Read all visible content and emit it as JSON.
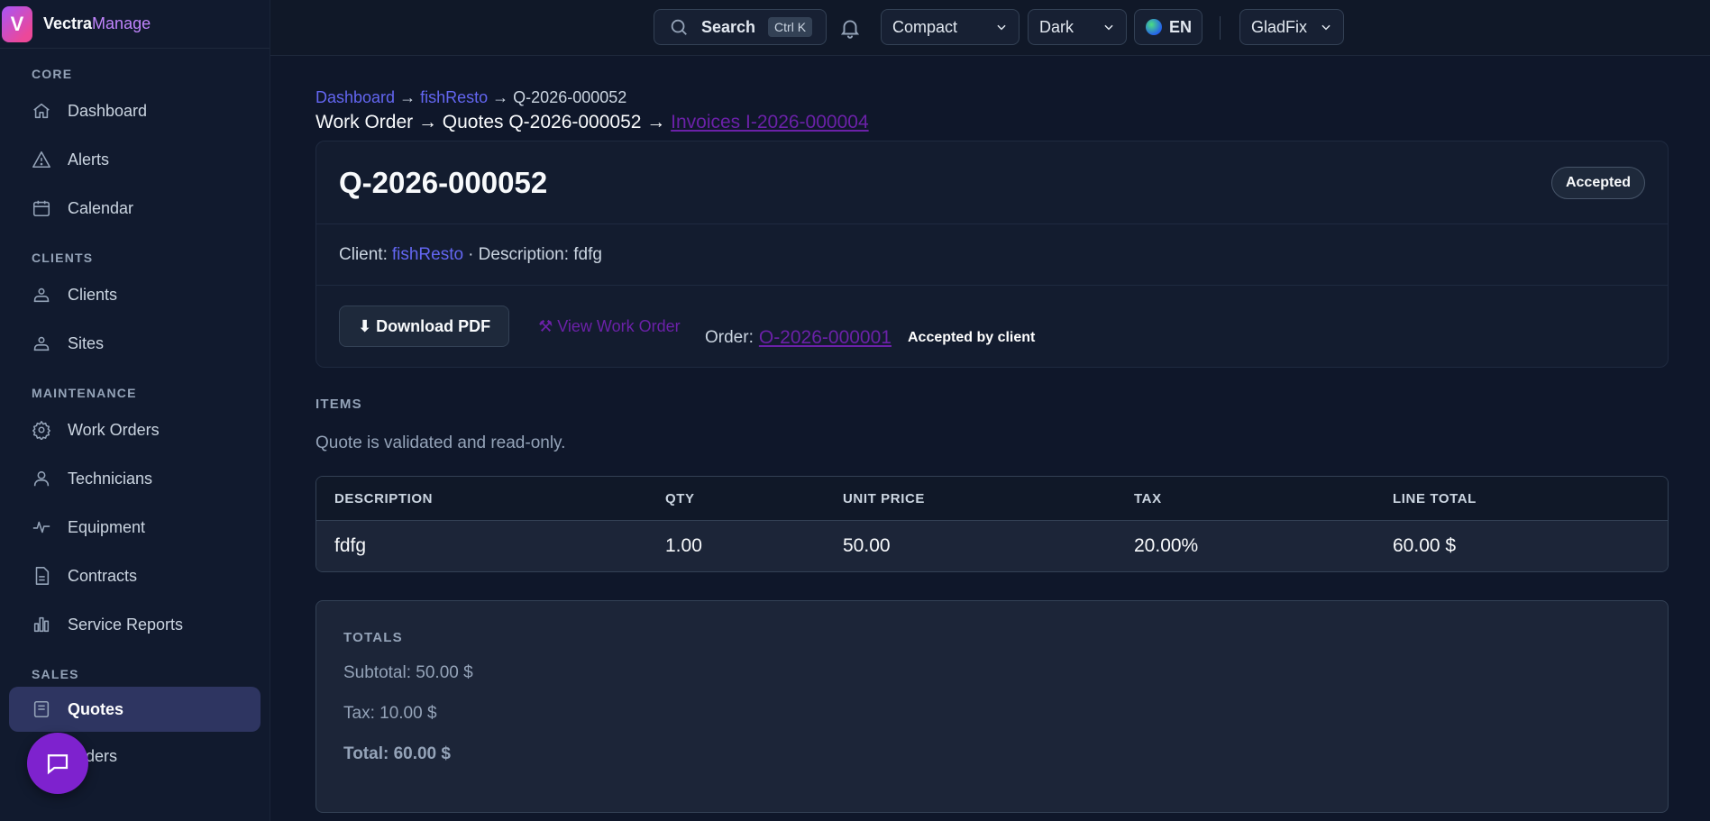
{
  "brand": {
    "part1": "Vectra",
    "part2": "Manage",
    "logo_letter": "V"
  },
  "sidebar": {
    "sections": [
      {
        "title": "CORE",
        "items": [
          {
            "label": "Dashboard",
            "icon": "home-icon"
          },
          {
            "label": "Alerts",
            "icon": "alert-triangle-icon"
          },
          {
            "label": "Calendar",
            "icon": "calendar-icon"
          }
        ]
      },
      {
        "title": "CLIENTS",
        "items": [
          {
            "label": "Clients",
            "icon": "users-icon"
          },
          {
            "label": "Sites",
            "icon": "sites-icon"
          }
        ]
      },
      {
        "title": "MAINTENANCE",
        "items": [
          {
            "label": "Work Orders",
            "icon": "gear-icon"
          },
          {
            "label": "Technicians",
            "icon": "user-icon"
          },
          {
            "label": "Equipment",
            "icon": "pulse-icon"
          },
          {
            "label": "Contracts",
            "icon": "document-icon"
          },
          {
            "label": "Service Reports",
            "icon": "bar-chart-icon"
          }
        ]
      },
      {
        "title": "SALES",
        "items": [
          {
            "label": "Quotes",
            "icon": "quote-icon",
            "active": true
          },
          {
            "label": "Orders",
            "icon": "orders-icon"
          }
        ]
      }
    ]
  },
  "topbar": {
    "search_label": "Search",
    "search_shortcut": "Ctrl K",
    "density": "Compact",
    "theme": "Dark",
    "language": "EN",
    "user": "GladFix"
  },
  "breadcrumb": {
    "item1": "Dashboard",
    "item2": "fishResto",
    "current": "Q-2026-000052",
    "sep": "→"
  },
  "flow": {
    "text": "Work Order → Quotes Q-2026-000052 →",
    "invoice_link": "Invoices I-2026-000004"
  },
  "quote": {
    "number": "Q-2026-000052",
    "status": "Accepted",
    "client_label": "Client:",
    "client_name": "fishResto",
    "description_text": "· Description: fdfg",
    "download_label": "⬇ Download PDF",
    "view_wo_label": "⚒ View Work Order",
    "order_label": "Order:",
    "order_number": "O-2026-000001",
    "accepted_by": "Accepted by client"
  },
  "items": {
    "section_title": "ITEMS",
    "note": "Quote is validated and read-only.",
    "columns": [
      "DESCRIPTION",
      "QTY",
      "UNIT PRICE",
      "TAX",
      "LINE TOTAL"
    ],
    "rows": [
      [
        "fdfg",
        "1.00",
        "50.00",
        "20.00%",
        "60.00 $"
      ]
    ]
  },
  "totals": {
    "title": "TOTALS",
    "subtotal": "Subtotal: 50.00 $",
    "tax": "Tax: 10.00 $",
    "total": "Total: 60.00 $"
  },
  "colors": {
    "accent": "#6366f1",
    "visited_link": "#6b21a8",
    "brand_gradient_start": "#a855f7",
    "fab": "#7e22ce"
  }
}
